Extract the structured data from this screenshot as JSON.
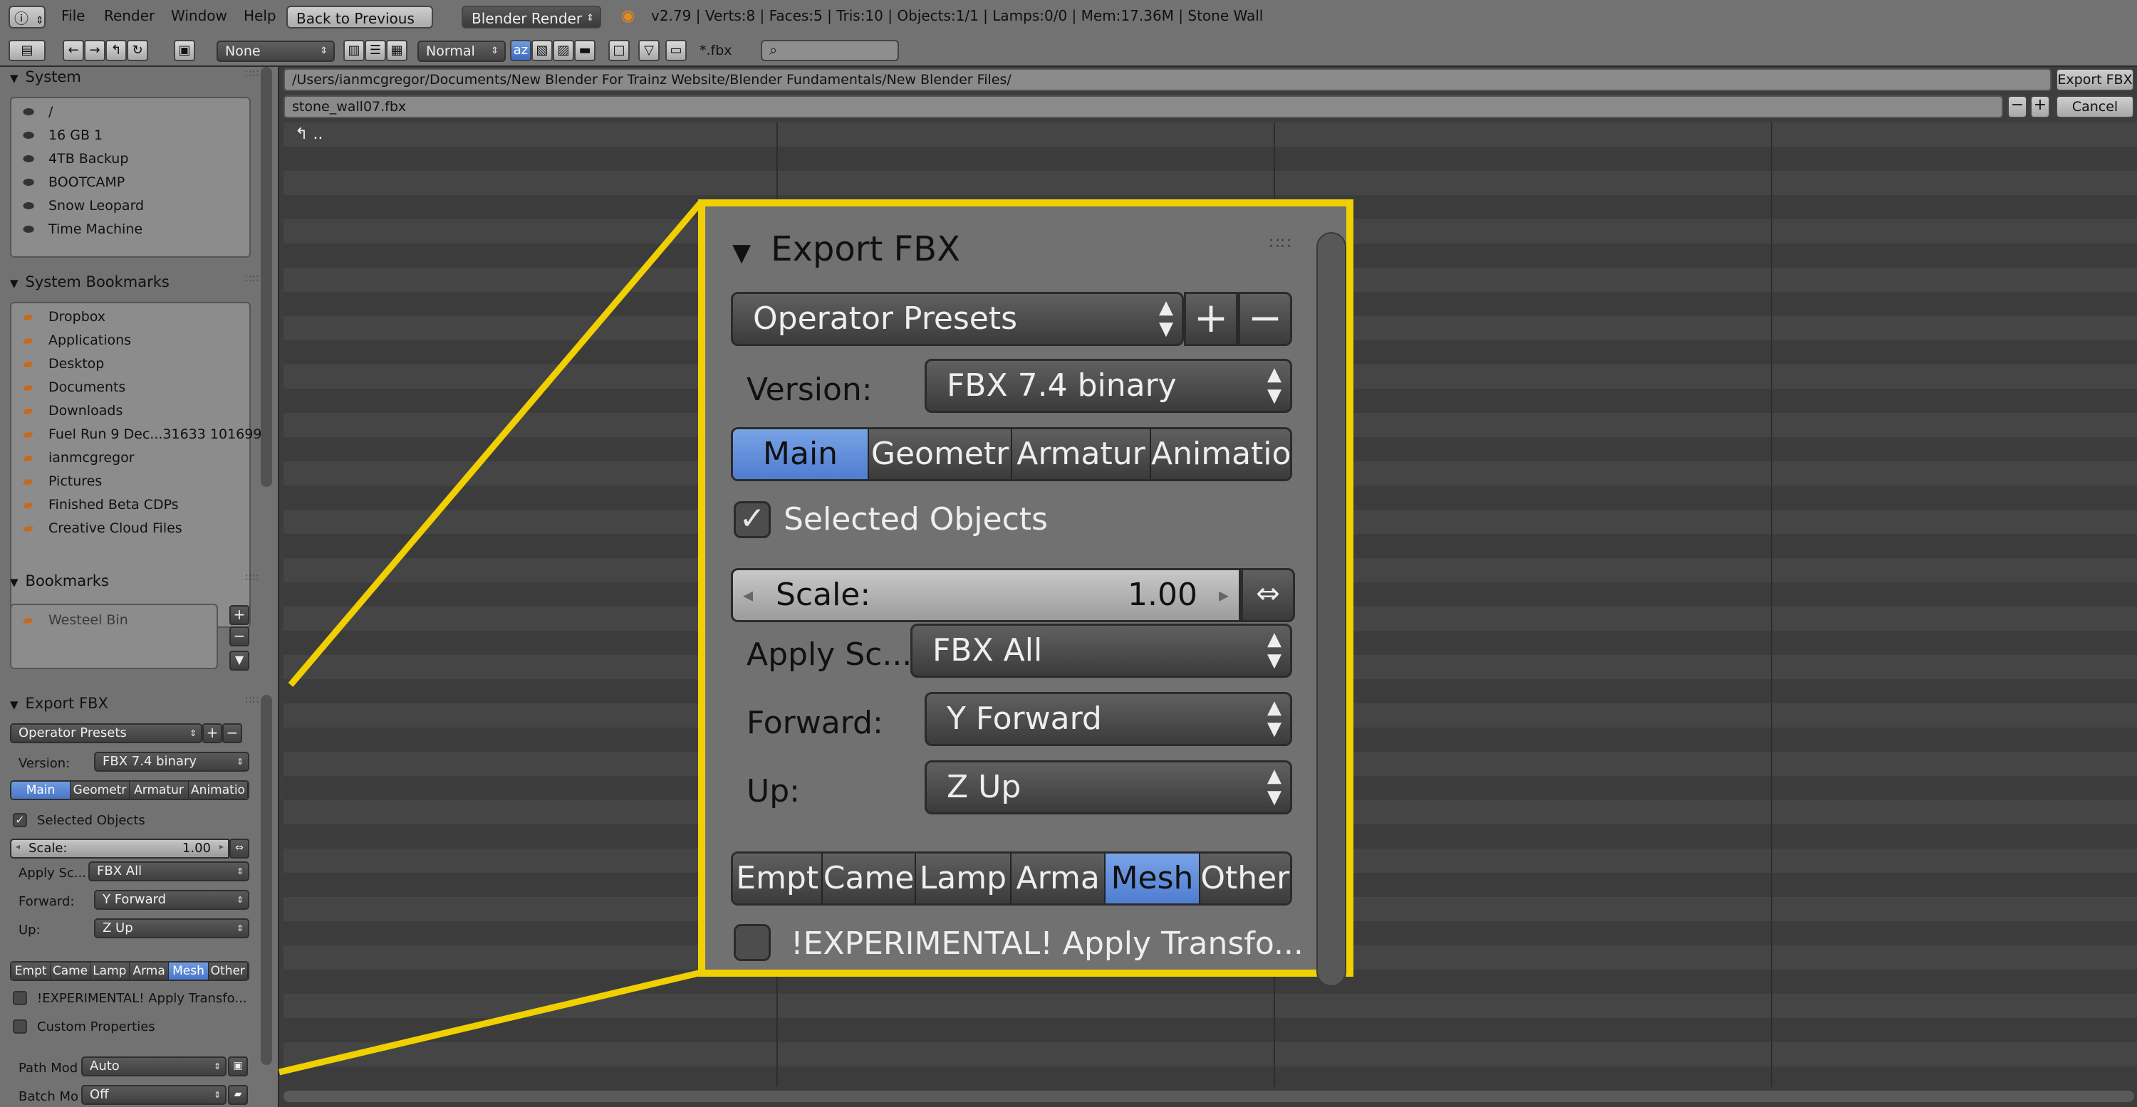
{
  "topbar": {
    "menu": [
      "File",
      "Render",
      "Window",
      "Help"
    ],
    "back_button": "Back to Previous",
    "render_engine": "Blender Render",
    "stats": "v2.79 | Verts:8 | Faces:5 | Tris:10 | Objects:1/1 | Lamps:0/0 | Mem:17.36M | Stone Wall"
  },
  "toolbar": {
    "filter_select": "None",
    "display_mode": "Normal",
    "filter_glob": "*.fbx",
    "search_placeholder": ""
  },
  "system": {
    "title": "System",
    "items": [
      "/",
      "16 GB 1",
      "4TB Backup",
      "BOOTCAMP",
      "Snow Leopard",
      "Time Machine"
    ]
  },
  "system_bookmarks": {
    "title": "System Bookmarks",
    "items": [
      "Dropbox",
      "Applications",
      "Desktop",
      "Documents",
      "Downloads",
      "Fuel Run 9 Dec...31633 101699",
      "ianmcgregor",
      "Pictures",
      "Finished Beta CDPs",
      "Creative Cloud Files"
    ]
  },
  "bookmarks": {
    "title": "Bookmarks",
    "items": [
      "Westeel Bin"
    ]
  },
  "export_panel": {
    "title": "Export FBX",
    "operator_presets": "Operator Presets",
    "version_label": "Version:",
    "version_value": "FBX 7.4 binary",
    "tabs": [
      "Main",
      "Geometr",
      "Armatur",
      "Animatio"
    ],
    "active_tab": "Main",
    "selected_objects_label": "Selected Objects",
    "selected_objects_checked": true,
    "scale_label": "Scale:",
    "scale_value": "1.00",
    "apply_scale_label": "Apply Sc...",
    "apply_scale_value": "FBX All",
    "forward_label": "Forward:",
    "forward_value": "Y Forward",
    "up_label": "Up:",
    "up_value": "Z Up",
    "object_types": [
      "Empt",
      "Came",
      "Lamp",
      "Arma",
      "Mesh",
      "Other"
    ],
    "active_object_type": "Mesh",
    "experimental_label": "!EXPERIMENTAL! Apply Transfo...",
    "custom_properties_label": "Custom Properties",
    "path_mode_label": "Path Mod",
    "path_mode_value": "Auto",
    "batch_mode_label": "Batch Mo",
    "batch_mode_value": "Off"
  },
  "file_browser": {
    "directory": "/Users/ianmcgregor/Documents/New Blender For Trainz Website/Blender Fundamentals/New Blender Files/",
    "filename": "stone_wall07.fbx",
    "export_button": "Export FBX",
    "cancel_button": "Cancel",
    "parent_dir": ".."
  },
  "colors": {
    "highlight_yellow": "#f0d000",
    "active_blue": "#5a86d4",
    "folder_orange": "#c36a1c"
  }
}
